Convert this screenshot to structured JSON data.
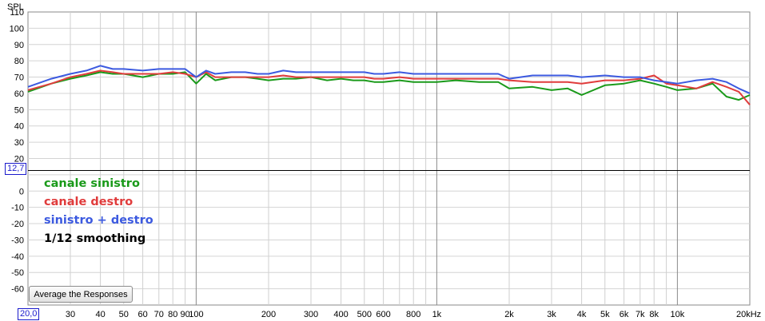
{
  "chart_data": {
    "type": "line",
    "ylabel": "SPL",
    "xunit_label": "20kHz",
    "xlim": [
      20,
      20000
    ],
    "ylim": [
      -70,
      110
    ],
    "xscale": "log",
    "grid": true,
    "y_ticks": [
      110,
      100,
      90,
      80,
      70,
      60,
      50,
      40,
      30,
      20,
      10,
      0,
      -10,
      -20,
      -30,
      -40,
      -50,
      -60
    ],
    "y_tick_labels": [
      "110",
      "100",
      "90",
      "80",
      "70",
      "60",
      "50",
      "40",
      "30",
      "20",
      "",
      "0",
      "-10",
      "-20",
      "-30",
      "-40",
      "-50",
      "-60"
    ],
    "x_ticks": [
      {
        "value": 30,
        "label": "30"
      },
      {
        "value": 40,
        "label": "40"
      },
      {
        "value": 50,
        "label": "50"
      },
      {
        "value": 60,
        "label": "60"
      },
      {
        "value": 70,
        "label": "70"
      },
      {
        "value": 80,
        "label": "80"
      },
      {
        "value": 90,
        "label": "90"
      },
      {
        "value": 100,
        "label": "100"
      },
      {
        "value": 200,
        "label": "200"
      },
      {
        "value": 300,
        "label": "300"
      },
      {
        "value": 400,
        "label": "400"
      },
      {
        "value": 500,
        "label": "500"
      },
      {
        "value": 600,
        "label": "600"
      },
      {
        "value": 800,
        "label": "800"
      },
      {
        "value": 1000,
        "label": "1k"
      },
      {
        "value": 2000,
        "label": "2k"
      },
      {
        "value": 3000,
        "label": "3k"
      },
      {
        "value": 4000,
        "label": "4k"
      },
      {
        "value": 5000,
        "label": "5k"
      },
      {
        "value": 6000,
        "label": "6k"
      },
      {
        "value": 7000,
        "label": "7k"
      },
      {
        "value": 8000,
        "label": "8k"
      },
      {
        "value": 10000,
        "label": "10k"
      }
    ],
    "x_start_label": "20,0",
    "reference_line": {
      "value": 12.7,
      "label": "12,7"
    },
    "legend_placement": "left-middle",
    "series": [
      {
        "name": "canale sinistro",
        "color": "#1a9a1a",
        "x": [
          20,
          25,
          30,
          35,
          40,
          45,
          50,
          60,
          70,
          80,
          90,
          100,
          110,
          120,
          140,
          160,
          180,
          200,
          230,
          260,
          300,
          350,
          400,
          450,
          500,
          550,
          600,
          700,
          800,
          900,
          1000,
          1200,
          1500,
          1800,
          2000,
          2500,
          3000,
          3500,
          4000,
          5000,
          6000,
          7000,
          8000,
          9000,
          10000,
          12000,
          14000,
          16000,
          18000,
          20000
        ],
        "y": [
          61,
          66,
          69,
          71,
          73,
          72,
          72,
          70,
          72,
          72,
          73,
          66,
          72,
          68,
          70,
          70,
          69,
          68,
          69,
          69,
          70,
          68,
          69,
          68,
          68,
          67,
          67,
          68,
          67,
          67,
          67,
          68,
          67,
          67,
          63,
          64,
          62,
          63,
          59,
          65,
          66,
          68,
          66,
          64,
          62,
          63,
          66,
          58,
          56,
          59
        ]
      },
      {
        "name": "canale destro",
        "color": "#e03c3c",
        "x": [
          20,
          25,
          30,
          35,
          40,
          45,
          50,
          60,
          70,
          80,
          90,
          100,
          110,
          120,
          140,
          160,
          180,
          200,
          230,
          260,
          300,
          350,
          400,
          450,
          500,
          550,
          600,
          700,
          800,
          900,
          1000,
          1200,
          1500,
          1800,
          2000,
          2500,
          3000,
          3500,
          4000,
          5000,
          6000,
          7000,
          8000,
          9000,
          10000,
          12000,
          14000,
          16000,
          18000,
          20000
        ],
        "y": [
          62,
          66,
          70,
          72,
          74,
          73,
          72,
          72,
          72,
          73,
          72,
          70,
          73,
          70,
          70,
          70,
          70,
          70,
          71,
          70,
          70,
          70,
          70,
          70,
          70,
          69,
          69,
          70,
          69,
          69,
          69,
          69,
          69,
          69,
          68,
          67,
          67,
          67,
          66,
          68,
          68,
          69,
          71,
          66,
          65,
          63,
          67,
          64,
          61,
          53
        ]
      },
      {
        "name": "sinistro + destro",
        "color": "#3c5ae0",
        "x": [
          20,
          25,
          30,
          35,
          40,
          45,
          50,
          60,
          70,
          80,
          90,
          100,
          110,
          120,
          140,
          160,
          180,
          200,
          230,
          260,
          300,
          350,
          400,
          450,
          500,
          550,
          600,
          700,
          800,
          900,
          1000,
          1200,
          1500,
          1800,
          2000,
          2500,
          3000,
          3500,
          4000,
          5000,
          6000,
          7000,
          8000,
          9000,
          10000,
          12000,
          14000,
          16000,
          18000,
          20000
        ],
        "y": [
          64,
          69,
          72,
          74,
          77,
          75,
          75,
          74,
          75,
          75,
          75,
          70,
          74,
          72,
          73,
          73,
          72,
          72,
          74,
          73,
          73,
          73,
          73,
          73,
          73,
          72,
          72,
          73,
          72,
          72,
          72,
          72,
          72,
          72,
          69,
          71,
          71,
          71,
          70,
          71,
          70,
          70,
          68,
          67,
          66,
          68,
          69,
          67,
          63,
          60
        ]
      }
    ],
    "annotations": [
      "1/12 smoothing"
    ]
  },
  "ui": {
    "average_button_label": "Average the Responses"
  }
}
